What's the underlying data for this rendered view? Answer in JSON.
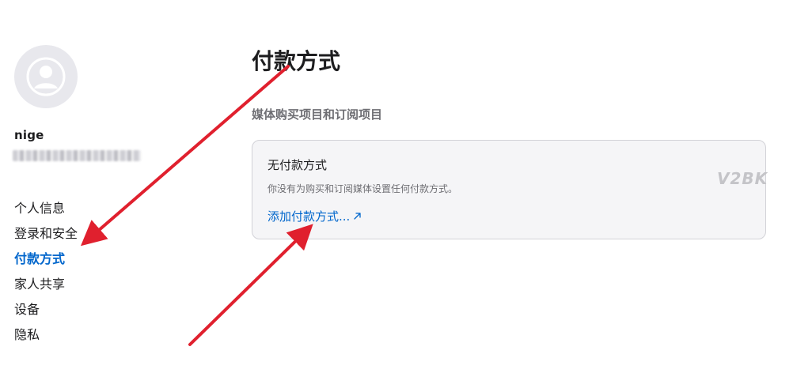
{
  "sidebar": {
    "username": "nige",
    "nav_items": [
      {
        "label": "个人信息",
        "active": false
      },
      {
        "label": "登录和安全",
        "active": false
      },
      {
        "label": "付款方式",
        "active": true
      },
      {
        "label": "家人共享",
        "active": false
      },
      {
        "label": "设备",
        "active": false
      },
      {
        "label": "隐私",
        "active": false
      }
    ]
  },
  "main": {
    "title": "付款方式",
    "section_title": "媒体购买项目和订阅项目",
    "card": {
      "title": "无付款方式",
      "description": "你没有为购买和订阅媒体设置任何付款方式。",
      "link_label": "添加付款方式...",
      "link_icon": "external-arrow-icon"
    }
  },
  "watermark": "V2BK",
  "colors": {
    "accent": "#0066cc",
    "annotation_arrow": "#e0202e",
    "card_bg": "#f5f5f7"
  }
}
